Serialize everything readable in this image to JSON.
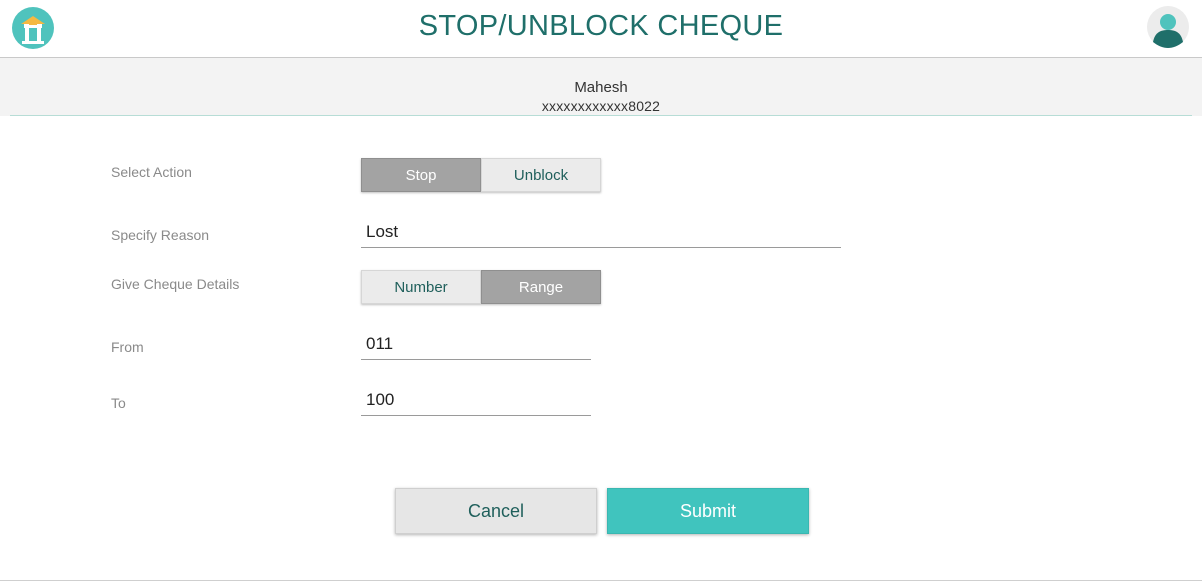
{
  "header": {
    "title": "STOP/UNBLOCK CHEQUE",
    "logo_icon": "bank-logo-icon",
    "avatar_icon": "user-avatar-icon"
  },
  "account": {
    "name": "Mahesh",
    "number": "xxxxxxxxxxxx8022"
  },
  "form": {
    "select_action": {
      "label": "Select Action",
      "options": [
        "Stop",
        "Unblock"
      ],
      "selected": "Stop"
    },
    "reason": {
      "label": "Specify Reason",
      "value": "Lost"
    },
    "cheque_details": {
      "label": "Give Cheque Details",
      "options": [
        "Number",
        "Range"
      ],
      "selected": "Range"
    },
    "from": {
      "label": "From",
      "value": "011"
    },
    "to": {
      "label": "To",
      "value": "100"
    }
  },
  "actions": {
    "cancel_label": "Cancel",
    "submit_label": "Submit"
  },
  "colors": {
    "accent": "#40c4be",
    "title": "#1f6f6a",
    "segment_active": "#a3a3a3"
  }
}
